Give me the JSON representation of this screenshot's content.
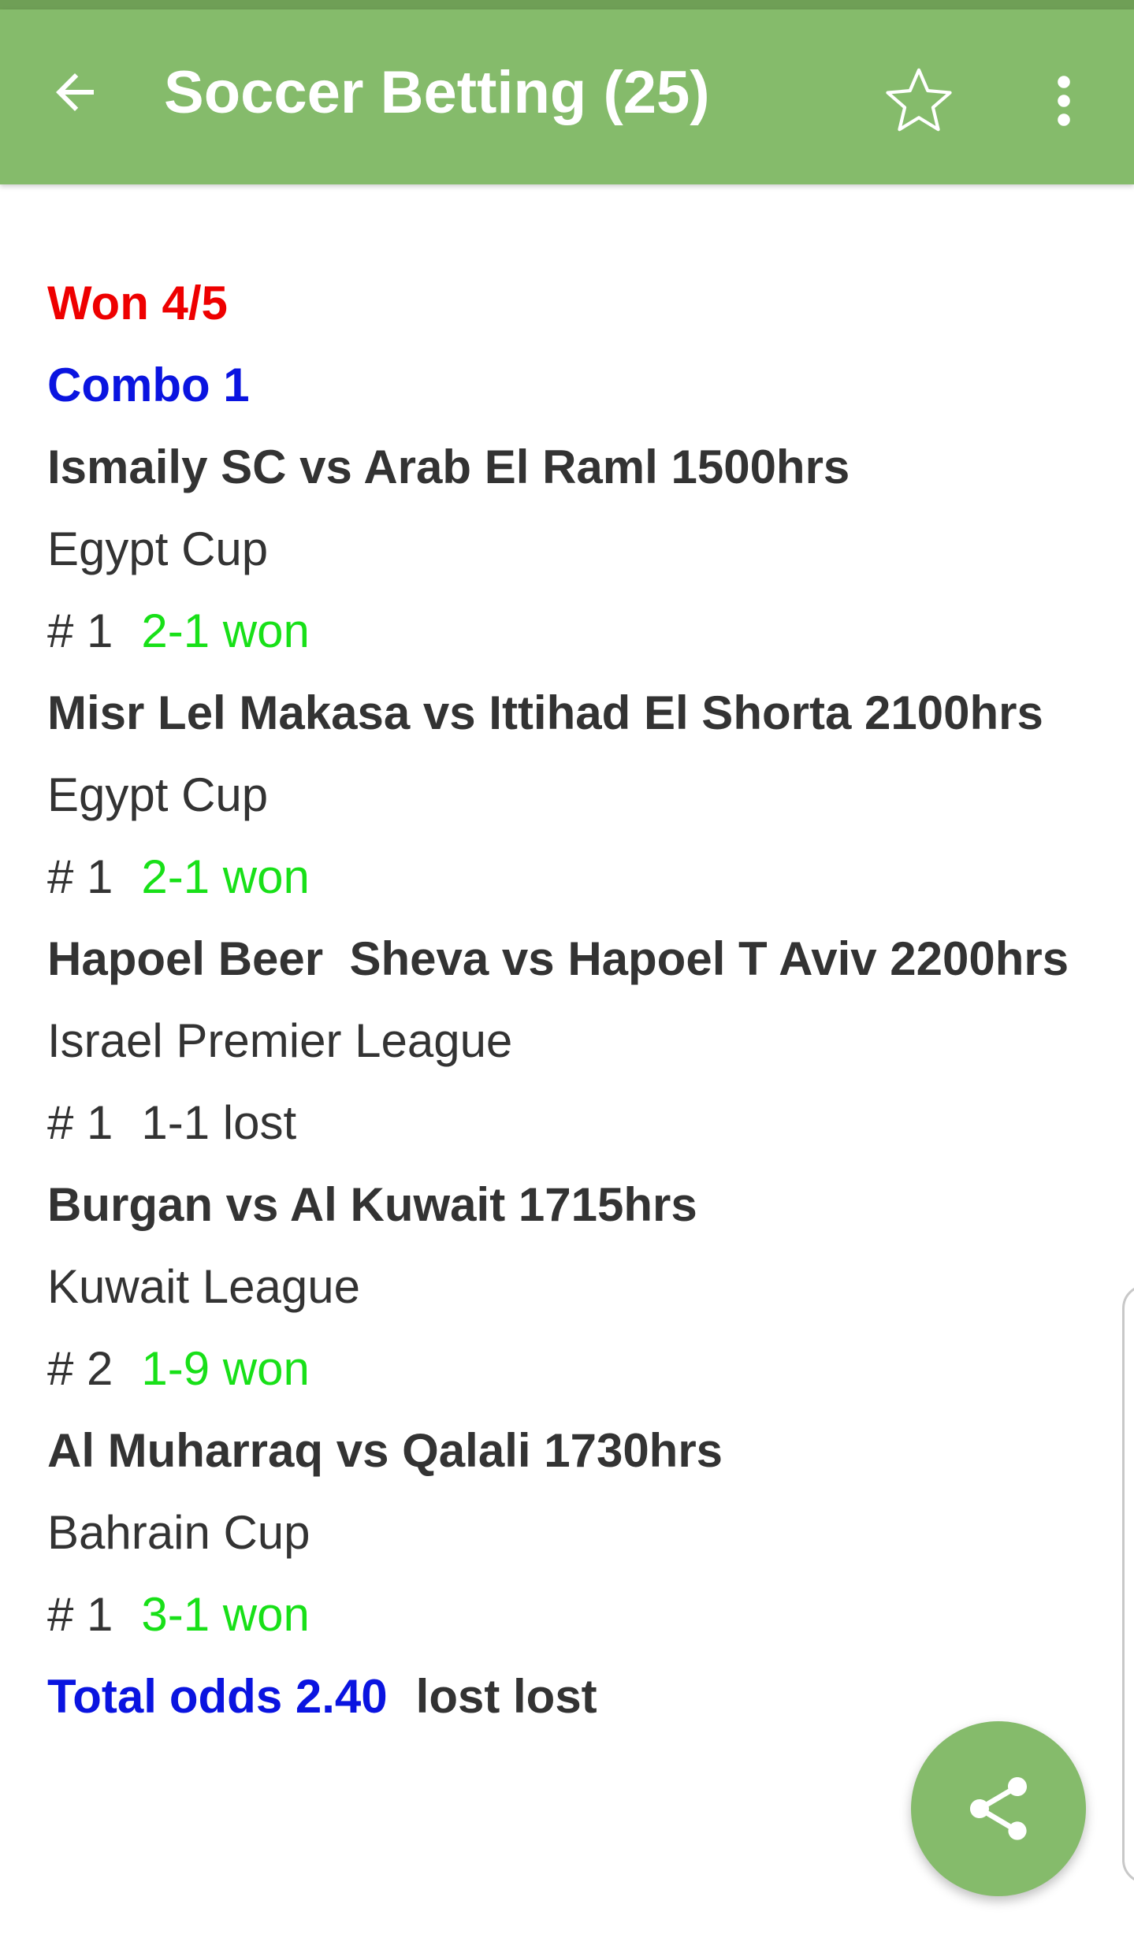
{
  "app_bar": {
    "title": "Soccer Betting (25)",
    "back_icon": "arrow-back-icon",
    "star_icon": "star-outline-icon",
    "menu_icon": "more-vert-icon",
    "color": "#85bb6b"
  },
  "post": {
    "result_header": "Won 4/5",
    "combo_title": "Combo 1",
    "matches": [
      {
        "teams": "Ismaily SC vs Arab El Raml 1500hrs",
        "competition": "Egypt Cup",
        "pick": "# 1",
        "outcome": "2-1 won"
      },
      {
        "teams": "Misr Lel Makasa vs Ittihad El Shorta 2100hrs",
        "competition": "Egypt Cup",
        "pick": "# 1",
        "outcome": "2-1 won"
      },
      {
        "teams": "Hapoel Beer  Sheva vs Hapoel T Aviv 2200hrs",
        "competition": "Israel Premier League",
        "pick": "# 1",
        "outcome": "1-1 lost"
      },
      {
        "teams": "Burgan vs Al Kuwait 1715hrs",
        "competition": "Kuwait League",
        "pick": "# 2",
        "outcome": "1-9 won"
      },
      {
        "teams": "Al Muharraq vs Qalali 1730hrs",
        "competition": "Bahrain Cup",
        "pick": "# 1",
        "outcome": "3-1 won"
      }
    ],
    "total_label": "Total",
    "total_odds": "odds 2.40",
    "total_result": "lost lost"
  },
  "fab": {
    "icon": "share-icon"
  },
  "colors": {
    "won_header": "#ee0000",
    "combo": "#0a14e0",
    "won_outcome": "#18e018",
    "text": "#333333"
  }
}
